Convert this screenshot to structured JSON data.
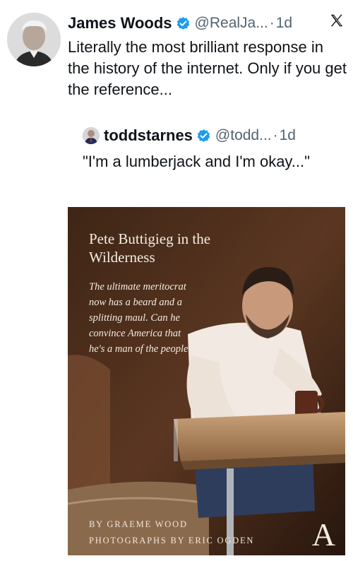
{
  "tweet": {
    "author_name": "James Woods",
    "author_handle": "@RealJa...",
    "separator": "·",
    "time": "1d",
    "text": "Literally the most brilliant response in the history of the internet. Only if you get the reference...",
    "avatar_icon": "avatar-photo-icon",
    "verified_icon": "verified-badge-icon",
    "close_icon": "x-logo-icon"
  },
  "quote": {
    "author_name": "toddstarnes",
    "author_handle": "@todd...",
    "separator": "·",
    "time": "1d",
    "text": "\"I'm a lumberjack and I'm okay...\""
  },
  "media": {
    "title": "Pete Buttigieg in the Wilderness",
    "dek": "The ultimate meritocrat now has a beard and a splitting maul. Can he convince America that he's a man of the people?",
    "credit_writer": "BY GRAEME WOOD",
    "credit_photos": "PHOTOGRAPHS BY ERIC OGDEN",
    "logo": "A"
  },
  "colors": {
    "verified_blue": "#1d9bf0",
    "text": "#0f1419",
    "muted": "#536471"
  }
}
